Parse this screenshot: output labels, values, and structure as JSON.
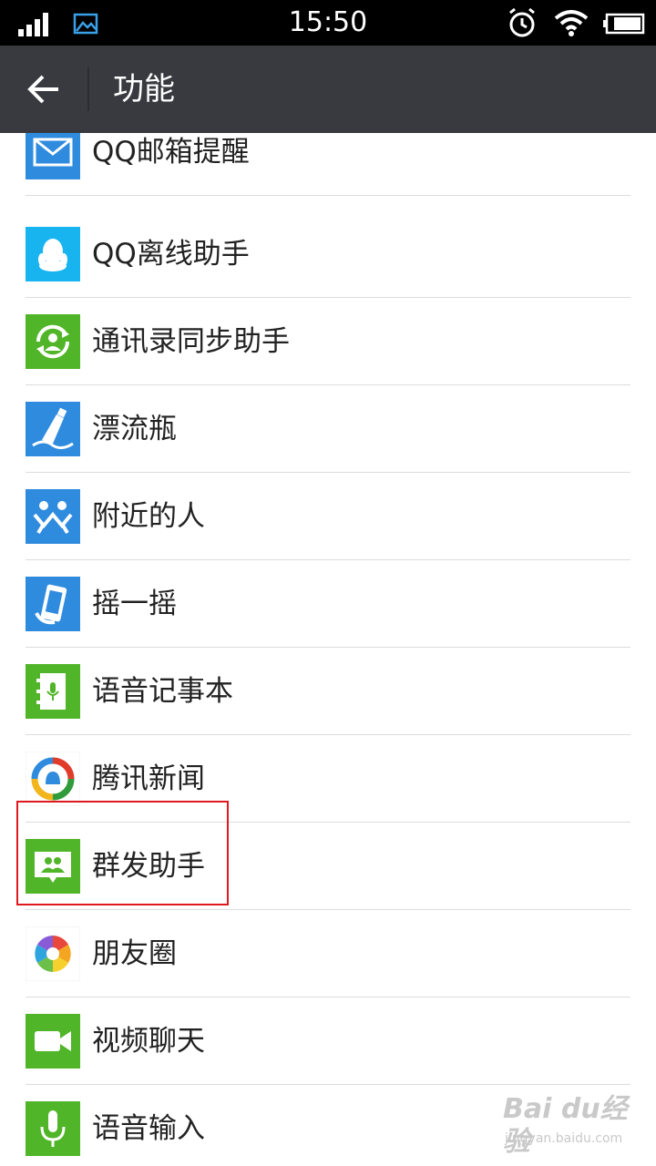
{
  "status_bar": {
    "time": "15:50"
  },
  "header": {
    "title": "功能"
  },
  "colors": {
    "blue": "#2f8bde",
    "green": "#50b528",
    "highlight": "#e0191e",
    "appbar": "#393a3f"
  },
  "items": [
    {
      "label": "QQ邮箱提醒",
      "icon": "mail-icon"
    },
    {
      "label": "QQ离线助手",
      "icon": "qq-penguin-icon"
    },
    {
      "label": "通讯录同步助手",
      "icon": "contact-sync-icon"
    },
    {
      "label": "漂流瓶",
      "icon": "drift-bottle-icon"
    },
    {
      "label": "附近的人",
      "icon": "people-nearby-icon"
    },
    {
      "label": "摇一摇",
      "icon": "shake-icon"
    },
    {
      "label": "语音记事本",
      "icon": "voice-notebook-icon"
    },
    {
      "label": "腾讯新闻",
      "icon": "tencent-news-icon"
    },
    {
      "label": "群发助手",
      "icon": "broadcast-assistant-icon"
    },
    {
      "label": "朋友圈",
      "icon": "moments-icon"
    },
    {
      "label": "视频聊天",
      "icon": "video-chat-icon"
    },
    {
      "label": "语音输入",
      "icon": "voice-input-icon"
    }
  ],
  "watermark": {
    "brand": "Bai du经验",
    "url": "jingyan.baidu.com"
  }
}
